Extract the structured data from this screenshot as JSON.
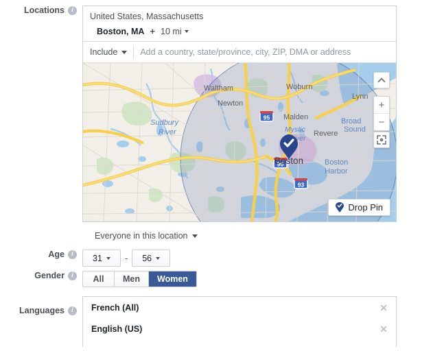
{
  "locations": {
    "label": "Locations",
    "info_icon": "info-icon",
    "country_region": "United States, Massachusetts",
    "city": "Boston, MA",
    "add_icon": "+",
    "radius": "10 mi",
    "radius_caret_icon": "chevron-down-icon",
    "include_label": "Include",
    "include_caret_icon": "chevron-down-icon",
    "search_placeholder": "Add a country, state/province, city, ZIP, DMA or address",
    "search_value": "",
    "audience_scope": "Everyone in this location",
    "audience_caret_icon": "chevron-down-icon"
  },
  "map": {
    "collapse_icon": "chevron-up-icon",
    "zoom_in_icon": "plus-icon",
    "zoom_out_icon": "minus-icon",
    "locate_icon": "recenter-icon",
    "drop_pin_label": "Drop Pin",
    "drop_pin_icon": "map-pin-icon",
    "marker_icon": "check-pin-icon",
    "center_city": "Boston",
    "place_labels": [
      "Woburn",
      "Lynn",
      "Malden",
      "Revere",
      "Broad Sound",
      "Mystic River",
      "Boston",
      "Boston Harbor",
      "Sudbury River",
      "Waltham",
      "Newton"
    ],
    "highway_shields": [
      "95",
      "90",
      "93"
    ],
    "colors": {
      "land": "#f2efe9",
      "water": "#a5cdec",
      "road": "#f6d04d",
      "park": "#cfe5c4",
      "radius_fill": "#8497bc",
      "pin": "#27468c"
    }
  },
  "age": {
    "label": "Age",
    "info_icon": "info-icon",
    "min": "31",
    "max": "56",
    "separator": "-",
    "caret_icon": "chevron-down-icon"
  },
  "gender": {
    "label": "Gender",
    "info_icon": "info-icon",
    "options": [
      "All",
      "Men",
      "Women"
    ],
    "selected": "Women",
    "accent_color": "#3b5998"
  },
  "languages": {
    "label": "Languages",
    "info_icon": "info-icon",
    "items": [
      {
        "name": "French (All)",
        "remove_icon": "close-icon"
      },
      {
        "name": "English (US)",
        "remove_icon": "close-icon"
      }
    ]
  }
}
